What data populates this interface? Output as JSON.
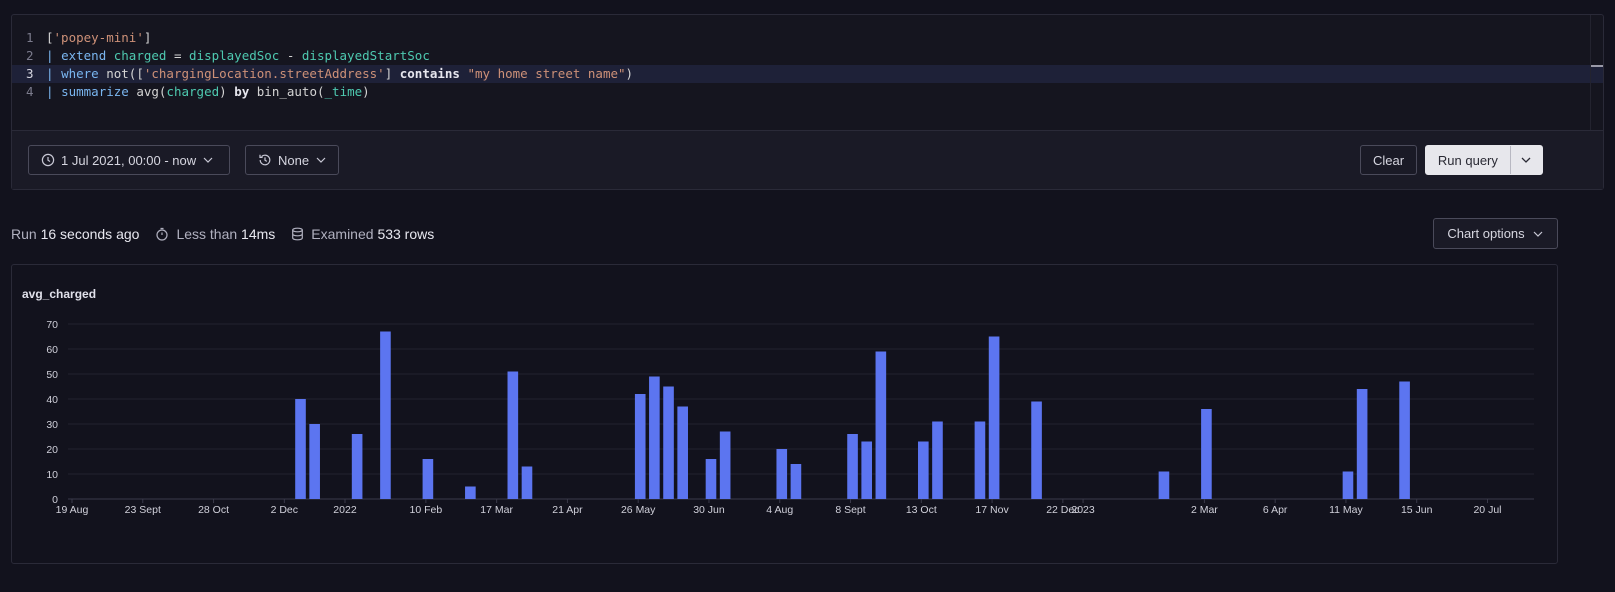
{
  "editor": {
    "lines": [
      {
        "num": "1",
        "active": false,
        "tokens": [
          {
            "t": "[",
            "c": "t-txt"
          },
          {
            "t": "'popey-mini'",
            "c": "t-str"
          },
          {
            "t": "]",
            "c": "t-txt"
          }
        ]
      },
      {
        "num": "2",
        "active": false,
        "tokens": [
          {
            "t": "| ",
            "c": "t-pipe"
          },
          {
            "t": "extend",
            "c": "t-kw"
          },
          {
            "t": " ",
            "c": "t-txt"
          },
          {
            "t": "charged",
            "c": "t-id"
          },
          {
            "t": " = ",
            "c": "t-txt"
          },
          {
            "t": "displayedSoc",
            "c": "t-id"
          },
          {
            "t": " - ",
            "c": "t-txt"
          },
          {
            "t": "displayedStartSoc",
            "c": "t-id"
          }
        ]
      },
      {
        "num": "3",
        "active": true,
        "tokens": [
          {
            "t": "| ",
            "c": "t-pipe"
          },
          {
            "t": "where",
            "c": "t-kw"
          },
          {
            "t": " not([",
            "c": "t-txt"
          },
          {
            "t": "'chargingLocation.streetAddress'",
            "c": "t-str"
          },
          {
            "t": "] ",
            "c": "t-txt"
          },
          {
            "t": "contains",
            "c": "t-bold"
          },
          {
            "t": " ",
            "c": "t-txt"
          },
          {
            "t": "\"my home street name\"",
            "c": "t-str"
          },
          {
            "t": ")",
            "c": "t-txt"
          }
        ]
      },
      {
        "num": "4",
        "active": false,
        "tokens": [
          {
            "t": "| ",
            "c": "t-pipe"
          },
          {
            "t": "summarize",
            "c": "t-kw"
          },
          {
            "t": " avg(",
            "c": "t-txt"
          },
          {
            "t": "charged",
            "c": "t-id"
          },
          {
            "t": ") ",
            "c": "t-txt"
          },
          {
            "t": "by",
            "c": "t-bold"
          },
          {
            "t": " bin_auto(",
            "c": "t-txt"
          },
          {
            "t": "_time",
            "c": "t-id"
          },
          {
            "t": ")",
            "c": "t-txt"
          }
        ]
      }
    ]
  },
  "toolbar": {
    "time_range": "1 Jul 2021, 00:00 - now",
    "compare": "None",
    "clear_label": "Clear",
    "run_label": "Run query"
  },
  "status": {
    "run_prefix": "Run",
    "run_value": "16 seconds ago",
    "time_prefix": "Less than",
    "time_value": "14ms",
    "rows_prefix": "Examined",
    "rows_value": "533 rows"
  },
  "chart_options_label": "Chart options",
  "chart_data": {
    "type": "bar",
    "title": "avg_charged",
    "xlabel": "",
    "ylabel": "",
    "ylim": [
      0,
      70
    ],
    "yticks": [
      0,
      10,
      20,
      30,
      40,
      50,
      60,
      70
    ],
    "grid": true,
    "bar_color": "#5c75f0",
    "x_range": [
      "2021-08-19",
      "2023-08-12"
    ],
    "xticks": [
      {
        "label": "19 Aug",
        "date": "2021-08-19"
      },
      {
        "label": "23 Sept",
        "date": "2021-09-23"
      },
      {
        "label": "28 Oct",
        "date": "2021-10-28"
      },
      {
        "label": "2 Dec",
        "date": "2021-12-02"
      },
      {
        "label": "2022",
        "date": "2022-01-01"
      },
      {
        "label": "10 Feb",
        "date": "2022-02-10"
      },
      {
        "label": "17 Mar",
        "date": "2022-03-17"
      },
      {
        "label": "21 Apr",
        "date": "2022-04-21"
      },
      {
        "label": "26 May",
        "date": "2022-05-26"
      },
      {
        "label": "30 Jun",
        "date": "2022-06-30"
      },
      {
        "label": "4 Aug",
        "date": "2022-08-04"
      },
      {
        "label": "8 Sept",
        "date": "2022-09-08"
      },
      {
        "label": "13 Oct",
        "date": "2022-10-13"
      },
      {
        "label": "17 Nov",
        "date": "2022-11-17"
      },
      {
        "label": "22 Dec",
        "date": "2022-12-22"
      },
      {
        "label": "2023",
        "date": "2023-01-01"
      },
      {
        "label": "2 Mar",
        "date": "2023-03-02"
      },
      {
        "label": "6 Apr",
        "date": "2023-04-06"
      },
      {
        "label": "11 May",
        "date": "2023-05-11"
      },
      {
        "label": "15 Jun",
        "date": "2023-06-15"
      },
      {
        "label": "20 Jul",
        "date": "2023-07-20"
      }
    ],
    "points": [
      {
        "date": "2021-12-10",
        "value": 40
      },
      {
        "date": "2021-12-17",
        "value": 30
      },
      {
        "date": "2022-01-07",
        "value": 26
      },
      {
        "date": "2022-01-21",
        "value": 67
      },
      {
        "date": "2022-02-11",
        "value": 16
      },
      {
        "date": "2022-03-04",
        "value": 5
      },
      {
        "date": "2022-03-25",
        "value": 51
      },
      {
        "date": "2022-04-01",
        "value": 13
      },
      {
        "date": "2022-05-27",
        "value": 42
      },
      {
        "date": "2022-06-03",
        "value": 49
      },
      {
        "date": "2022-06-10",
        "value": 45
      },
      {
        "date": "2022-06-17",
        "value": 37
      },
      {
        "date": "2022-07-01",
        "value": 16
      },
      {
        "date": "2022-07-08",
        "value": 27
      },
      {
        "date": "2022-08-05",
        "value": 20
      },
      {
        "date": "2022-08-12",
        "value": 14
      },
      {
        "date": "2022-09-09",
        "value": 26
      },
      {
        "date": "2022-09-16",
        "value": 23
      },
      {
        "date": "2022-09-23",
        "value": 59
      },
      {
        "date": "2022-10-14",
        "value": 23
      },
      {
        "date": "2022-10-21",
        "value": 31
      },
      {
        "date": "2022-11-11",
        "value": 31
      },
      {
        "date": "2022-11-18",
        "value": 65
      },
      {
        "date": "2022-12-09",
        "value": 39
      },
      {
        "date": "2023-02-10",
        "value": 11
      },
      {
        "date": "2023-03-03",
        "value": 36
      },
      {
        "date": "2023-05-12",
        "value": 11
      },
      {
        "date": "2023-05-19",
        "value": 44
      },
      {
        "date": "2023-06-09",
        "value": 47
      }
    ]
  }
}
